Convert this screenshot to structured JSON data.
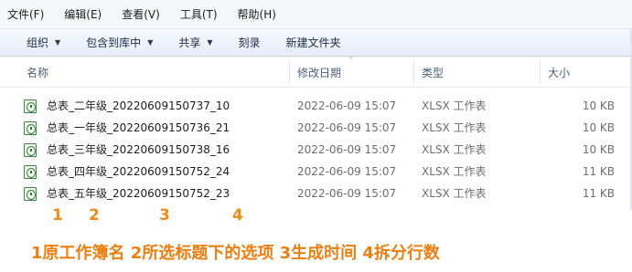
{
  "menu": [
    "文件(F)",
    "编辑(E)",
    "查看(V)",
    "工具(T)",
    "帮助(H)"
  ],
  "toolbar": [
    {
      "label": "组织",
      "caret": true
    },
    {
      "label": "包含到库中",
      "caret": true
    },
    {
      "label": "共享",
      "caret": true
    },
    {
      "label": "刻录",
      "caret": false
    },
    {
      "label": "新建文件夹",
      "caret": false
    }
  ],
  "columns": {
    "name": "名称",
    "date": "修改日期",
    "type": "类型",
    "size": "大小"
  },
  "sort_indicator": "^",
  "files": [
    {
      "name": "总表_二年级_20220609150737_10",
      "date": "2022-06-09 15:07",
      "type": "XLSX 工作表",
      "size": "10 KB",
      "icon": "excel-file-icon"
    },
    {
      "name": "总表_一年级_20220609150736_21",
      "date": "2022-06-09 15:07",
      "type": "XLSX 工作表",
      "size": "10 KB",
      "icon": "excel-file-icon"
    },
    {
      "name": "总表_三年级_20220609150738_16",
      "date": "2022-06-09 15:07",
      "type": "XLSX 工作表",
      "size": "10 KB",
      "icon": "excel-file-icon"
    },
    {
      "name": "总表_四年级_20220609150752_24",
      "date": "2022-06-09 15:07",
      "type": "XLSX 工作表",
      "size": "11 KB",
      "icon": "excel-file-icon"
    },
    {
      "name": "总表_五年级_20220609150752_23",
      "date": "2022-06-09 15:07",
      "type": "XLSX 工作表",
      "size": "11 KB",
      "icon": "excel-file-icon"
    }
  ],
  "annotations": [
    "1",
    "2",
    "3",
    "4"
  ],
  "caption": "1原工作簿名  2所选标题下的选项  3生成时间  4拆分行数",
  "colors": {
    "accent": "#f08b16",
    "toolbar_bg": "#e5edf7",
    "excel_green": "#2f7d36"
  }
}
